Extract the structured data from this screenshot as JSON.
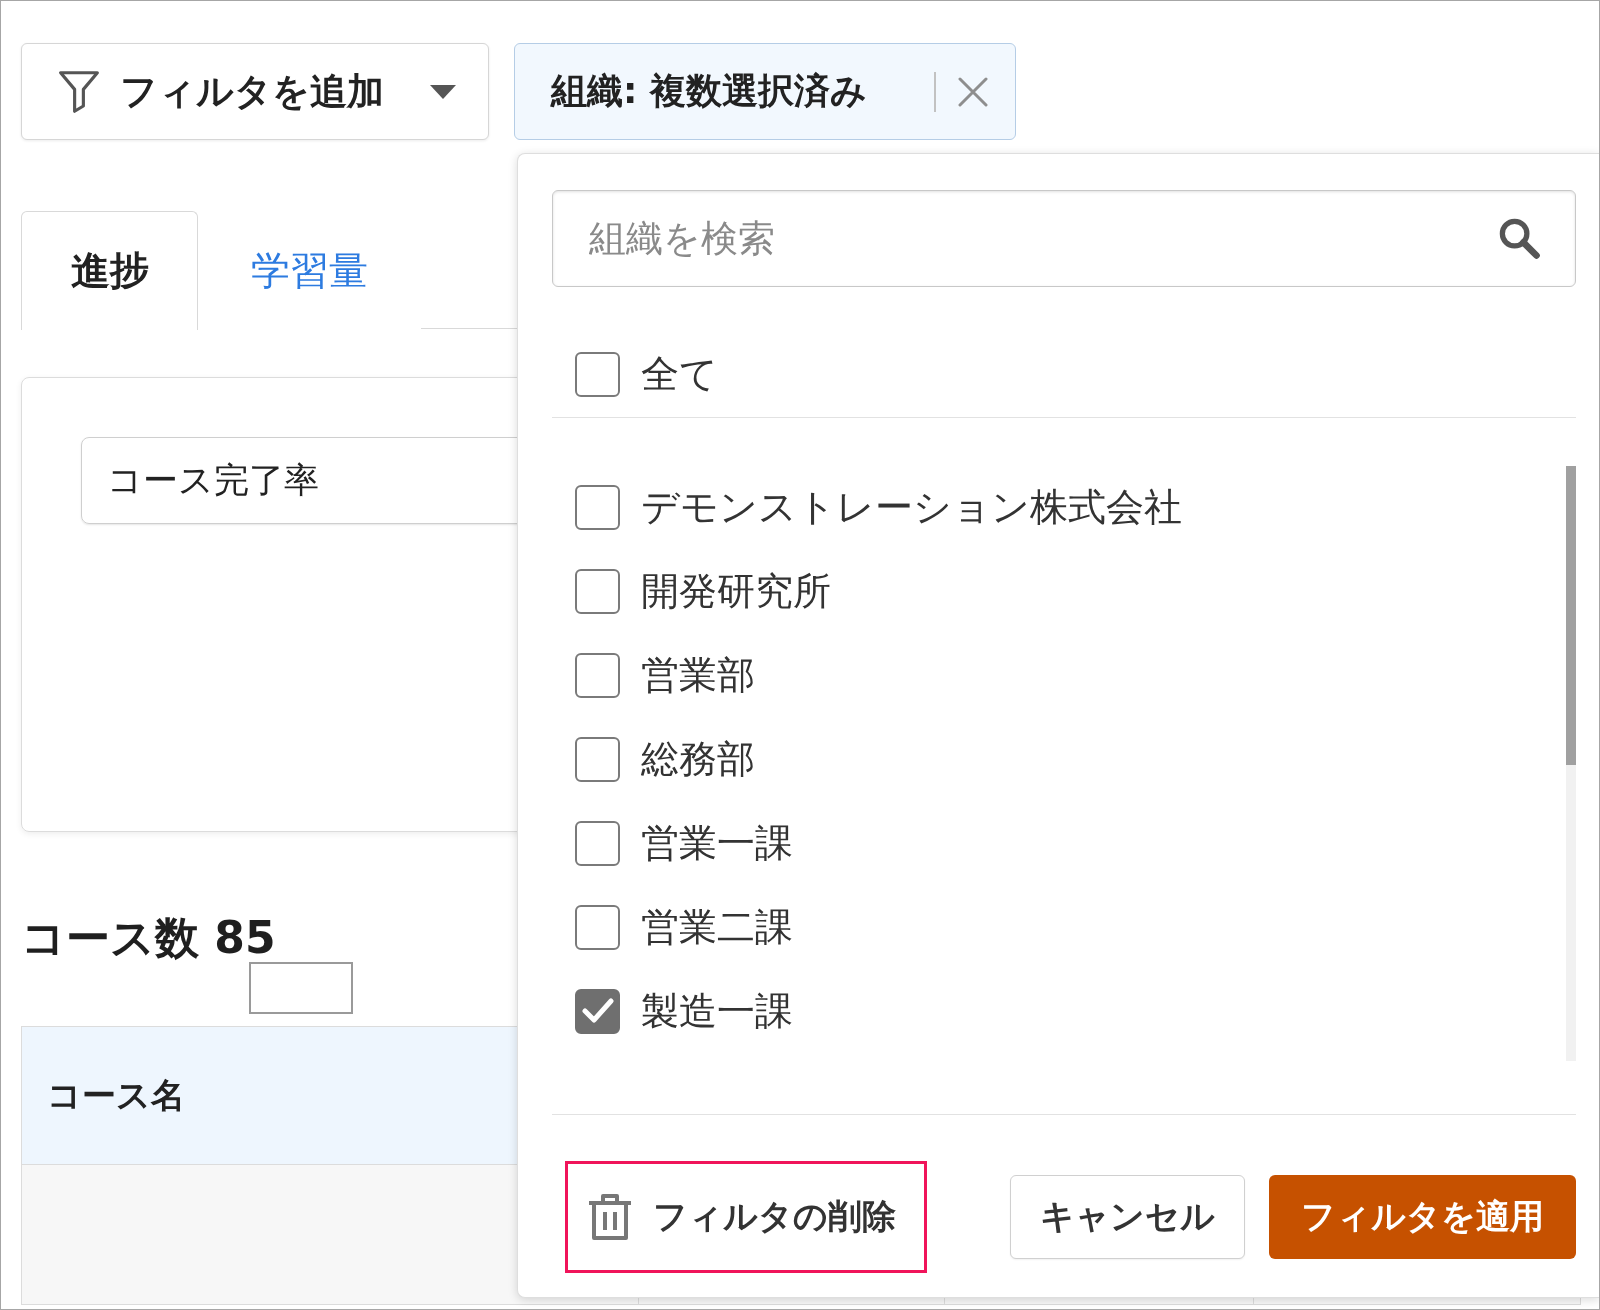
{
  "filter_bar": {
    "add_filter_button": {
      "label": "フィルタを追加"
    },
    "active_filter": {
      "label": "組織: 複数選択済み"
    }
  },
  "tabs": [
    {
      "label": "進捗",
      "selected": true
    },
    {
      "label": "学習量",
      "selected": false
    }
  ],
  "chart_card": {
    "metric_select": {
      "value": "コース完了率"
    }
  },
  "course_count": {
    "title": "コース数 85"
  },
  "table": {
    "columns": [
      "コース名"
    ]
  },
  "org_filter_panel": {
    "search": {
      "placeholder": "組織を検索"
    },
    "select_all": {
      "label": "全て",
      "checked": false
    },
    "options": [
      {
        "label": "デモンストレーション株式会社",
        "checked": false
      },
      {
        "label": "開発研究所",
        "checked": false
      },
      {
        "label": "営業部",
        "checked": false
      },
      {
        "label": "総務部",
        "checked": false
      },
      {
        "label": "営業一課",
        "checked": false
      },
      {
        "label": "営業二課",
        "checked": false
      },
      {
        "label": "製造一課",
        "checked": true
      }
    ],
    "footer": {
      "clear_button": {
        "label": "フィルタの削除",
        "highlighted": true
      },
      "cancel_button": {
        "label": "キャンセル"
      },
      "apply_button": {
        "label": "フィルタを適用"
      }
    }
  }
}
